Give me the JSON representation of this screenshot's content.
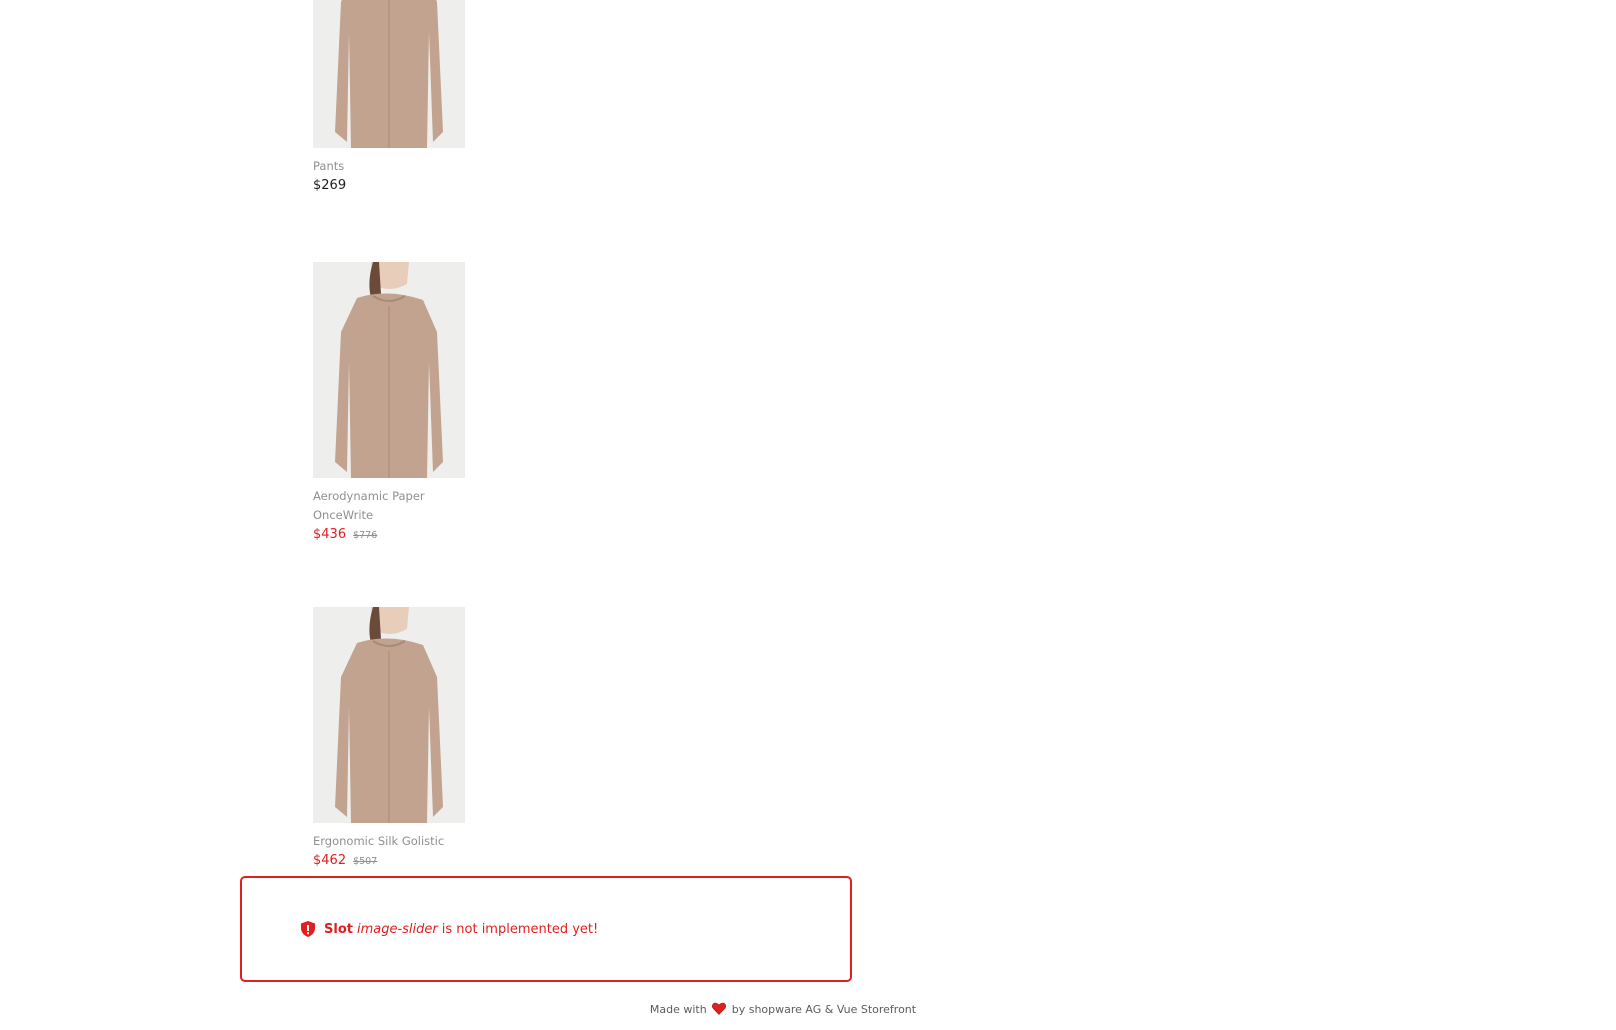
{
  "products": [
    {
      "name": "Pants",
      "price": "$269",
      "old_price": "",
      "on_sale": false
    },
    {
      "name": "Aerodynamic Paper OnceWrite",
      "price": "$436",
      "old_price": "$776",
      "on_sale": true
    },
    {
      "name": "Ergonomic Silk Golistic",
      "price": "$462",
      "old_price": "$507",
      "on_sale": true
    }
  ],
  "slot_error": {
    "prefix": "Slot",
    "slot_name": "image-slider",
    "message": "is not implemented yet!",
    "icon": "shield-alert-icon"
  },
  "footer": {
    "made_with": "Made with",
    "icon": "heart-icon",
    "credits": "by shopware AG & Vue Storefront"
  },
  "colors": {
    "accent_red": "#e02020",
    "muted_text": "#8d8f92",
    "product_beige": "#c2a390"
  }
}
